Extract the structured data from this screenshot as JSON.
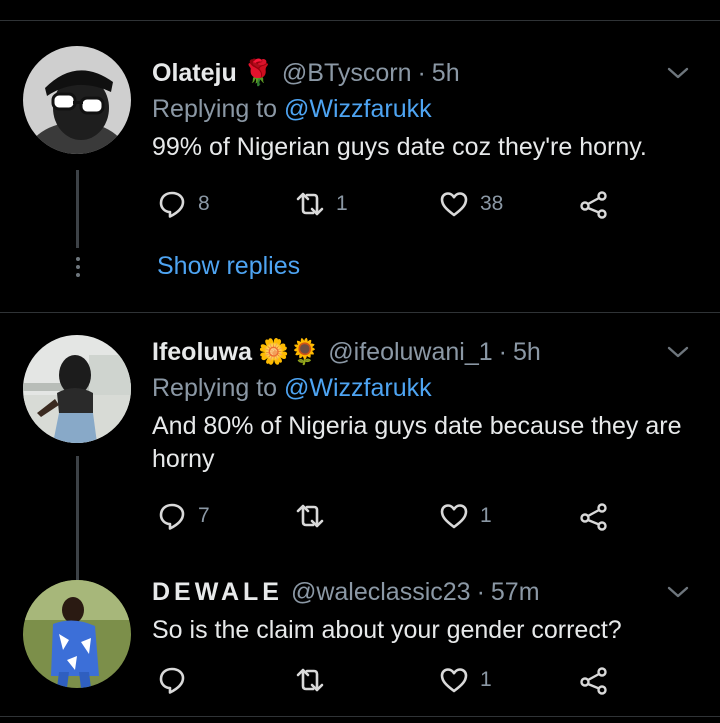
{
  "tweets": [
    {
      "name": "Olateju",
      "emoji": "🌹",
      "handle": "@BTyscorn",
      "separator": "·",
      "time": "5h",
      "replying_prefix": "Replying to ",
      "replying_to": "@Wizzfarukk",
      "text": "99% of Nigerian guys date coz they're horny.",
      "replies": "8",
      "retweets": "1",
      "likes": "38"
    },
    {
      "name": "Ifeoluwa",
      "emoji": "🌼🌻",
      "handle": "@ifeoluwani_1",
      "separator": "·",
      "time": "5h",
      "replying_prefix": "Replying to ",
      "replying_to": "@Wizzfarukk",
      "text": "And 80% of Nigeria guys date because they are horny",
      "replies": "7",
      "retweets": "",
      "likes": "1"
    },
    {
      "name": "DEWALE",
      "emoji": "",
      "handle": "@waleclassic23",
      "separator": "·",
      "time": "57m",
      "text": "So is the claim about your gender correct?",
      "replies": "",
      "retweets": "",
      "likes": "1"
    }
  ],
  "show_replies_label": "Show replies",
  "colors": {
    "background": "#000000",
    "link": "#4ea4f2",
    "muted": "#8b98a5",
    "text": "#e7e9ea"
  },
  "icons": [
    "reply-icon",
    "retweet-icon",
    "like-icon",
    "share-icon",
    "chevron-down-icon"
  ]
}
